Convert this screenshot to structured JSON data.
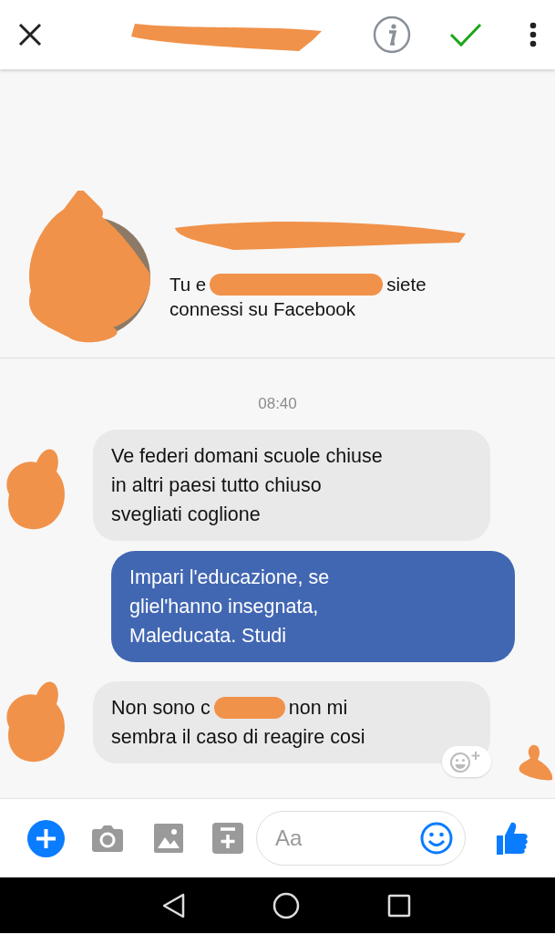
{
  "profile": {
    "subtitle_lines": [
      [
        "Tu e",
        "siete"
      ],
      [
        "connessi su Facebook"
      ]
    ]
  },
  "timestamp": "08:40",
  "messages": [
    {
      "kind": "received",
      "lines": [
        [
          "Ve federi domani scuole chiuse"
        ],
        [
          "in altri paesi tutto chiuso"
        ],
        [
          "svegliati coglione"
        ]
      ]
    },
    {
      "kind": "sent",
      "lines": [
        [
          "Impari l'educazione, se"
        ],
        [
          "gliel'hanno insegnata,"
        ],
        [
          "Maleducata. Studi"
        ]
      ]
    },
    {
      "kind": "received",
      "lines": [
        [
          "Non sono c",
          "non mi"
        ],
        [
          "sembra il caso di reagire cosi"
        ]
      ]
    }
  ],
  "composer": {
    "placeholder": "Aa"
  }
}
